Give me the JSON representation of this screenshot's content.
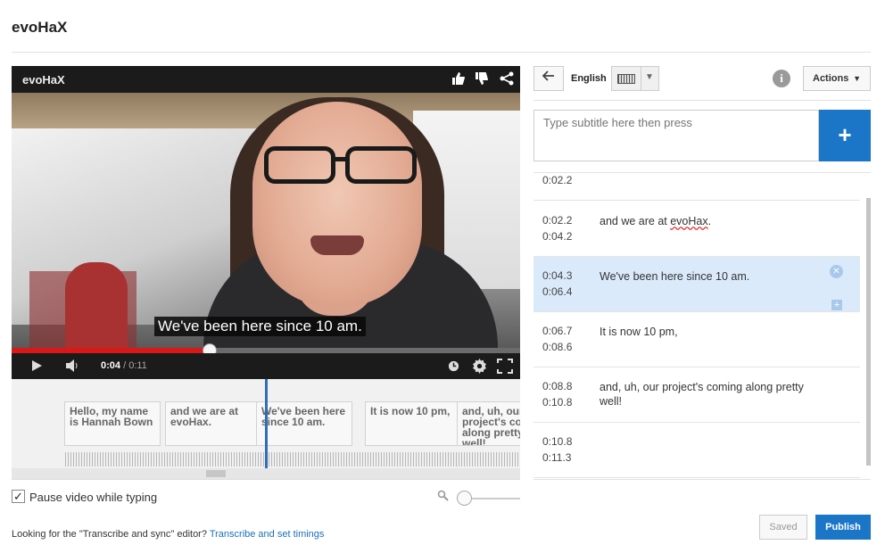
{
  "page": {
    "title": "evoHaX"
  },
  "player": {
    "title": "evoHaX",
    "caption": "We've been here since 10 am.",
    "time_current": "0:04",
    "time_total": " / 0:11",
    "progress": 0.39,
    "icons": [
      "thumbs-up-icon",
      "thumbs-down-icon",
      "share-icon",
      "play-icon",
      "volume-icon",
      "clock-icon",
      "gear-icon",
      "fullscreen-icon"
    ]
  },
  "timeline": {
    "cues": [
      "Hello, my name is Hannah Bown",
      "and we are at evoHax.",
      "We've been here since 10 am.",
      "It is now 10 pm,",
      "and, uh, our project's coming along pretty well!"
    ]
  },
  "pause_label": "Pause video while typing",
  "footer": {
    "text": "Looking for the \"Transcribe and sync\" editor? ",
    "link": "Transcribe and set timings"
  },
  "editor": {
    "language": "English",
    "actions_label": "Actions",
    "input_placeholder": "Type subtitle here then press",
    "add_label": "+",
    "partial_time": "0:02.2",
    "rows": [
      {
        "start": "0:02.2",
        "end": "0:04.2",
        "text_before": "and we are at ",
        "text_spell": "evoHax",
        "text_after": "."
      },
      {
        "start": "0:04.3",
        "end": "0:06.4",
        "text_before": "We've been here since 10 am.",
        "text_spell": "",
        "text_after": ""
      },
      {
        "start": "0:06.7",
        "end": "0:08.6",
        "text_before": "It is now 10 pm,",
        "text_spell": "",
        "text_after": ""
      },
      {
        "start": "0:08.8",
        "end": "0:10.8",
        "text_before": " and, uh, our project's coming along pretty well!",
        "text_spell": "",
        "text_after": ""
      },
      {
        "start": "0:10.8",
        "end": "0:11.3",
        "text_before": "",
        "text_spell": "",
        "text_after": ""
      }
    ],
    "saved_label": "Saved",
    "publish_label": "Publish"
  }
}
